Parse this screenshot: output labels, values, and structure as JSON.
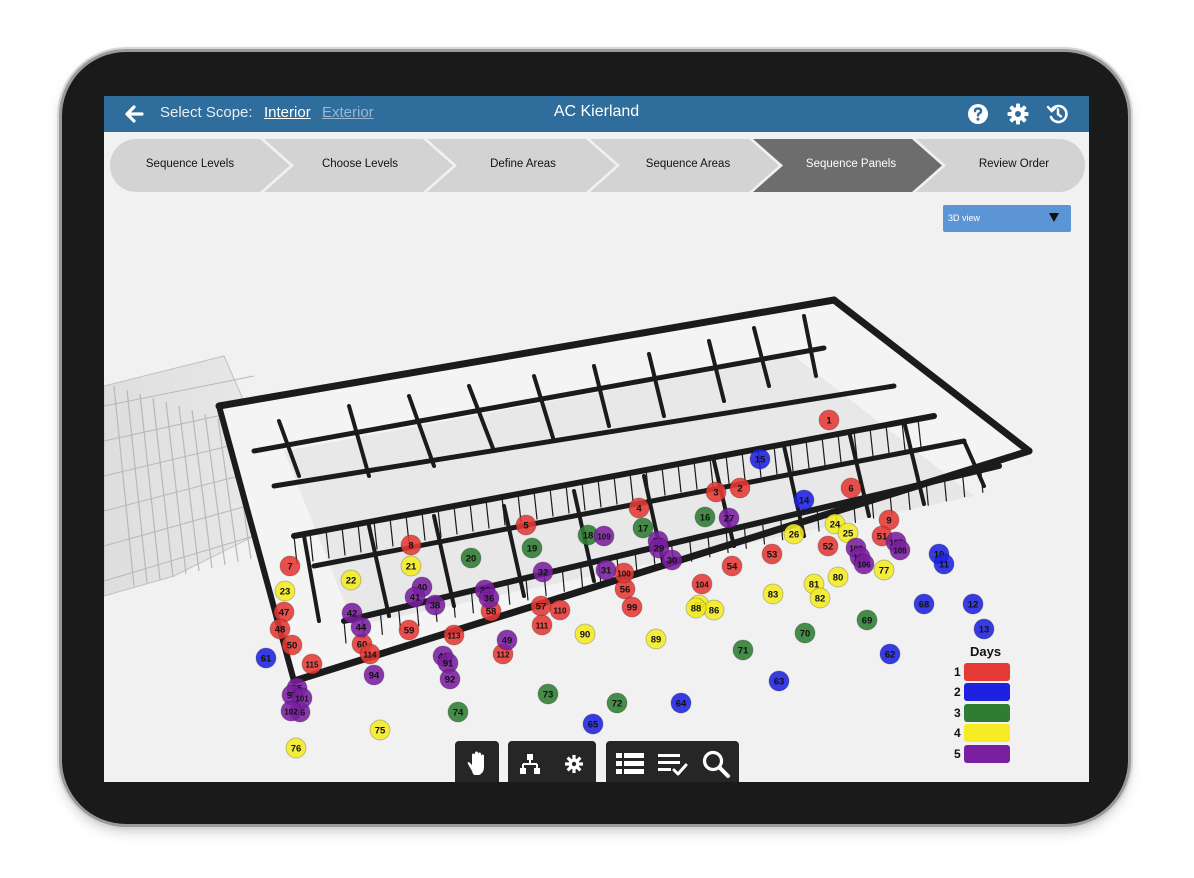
{
  "header": {
    "scope_label": "Select Scope:",
    "scope_interior": "Interior",
    "scope_exterior": "Exterior",
    "title": "AC Kierland",
    "icons": [
      "back-arrow-icon",
      "help-icon",
      "gear-icon",
      "history-icon"
    ]
  },
  "steps": [
    {
      "label": "Sequence Levels",
      "active": false
    },
    {
      "label": "Choose Levels",
      "active": false
    },
    {
      "label": "Define Areas",
      "active": false
    },
    {
      "label": "Sequence Areas",
      "active": false
    },
    {
      "label": "Sequence Panels",
      "active": true
    },
    {
      "label": "Review Order",
      "active": false
    }
  ],
  "view_select": {
    "selected": "3D view"
  },
  "legend": {
    "title": "Days",
    "items": [
      {
        "label": "1",
        "color": "#e53935"
      },
      {
        "label": "2",
        "color": "#1e22e0"
      },
      {
        "label": "3",
        "color": "#2e7d32"
      },
      {
        "label": "4",
        "color": "#f5ec24"
      },
      {
        "label": "5",
        "color": "#7b1fa2"
      }
    ]
  },
  "toolbar": {
    "icons": [
      "hand-pan-icon",
      "hierarchy-icon",
      "settings-icon",
      "list-icon",
      "checklist-icon",
      "search-icon"
    ]
  },
  "panels": [
    {
      "n": "1",
      "day": 1
    },
    {
      "n": "2",
      "day": 1
    },
    {
      "n": "3",
      "day": 1
    },
    {
      "n": "4",
      "day": 1
    },
    {
      "n": "5",
      "day": 1
    },
    {
      "n": "6",
      "day": 1
    },
    {
      "n": "7",
      "day": 1
    },
    {
      "n": "8",
      "day": 1
    },
    {
      "n": "9",
      "day": 1
    },
    {
      "n": "51",
      "day": 1
    },
    {
      "n": "52",
      "day": 1
    },
    {
      "n": "53",
      "day": 1
    },
    {
      "n": "54",
      "day": 1
    },
    {
      "n": "56",
      "day": 1
    },
    {
      "n": "57",
      "day": 1
    },
    {
      "n": "58",
      "day": 1
    },
    {
      "n": "59",
      "day": 1
    },
    {
      "n": "60",
      "day": 1
    },
    {
      "n": "99",
      "day": 1
    },
    {
      "n": "100",
      "day": 1
    },
    {
      "n": "104",
      "day": 1
    },
    {
      "n": "110",
      "day": 1
    },
    {
      "n": "111",
      "day": 1
    },
    {
      "n": "112",
      "day": 1
    },
    {
      "n": "113",
      "day": 1
    },
    {
      "n": "114",
      "day": 1
    },
    {
      "n": "115",
      "day": 1
    },
    {
      "n": "47",
      "day": 1
    },
    {
      "n": "48",
      "day": 1
    },
    {
      "n": "50",
      "day": 1
    },
    {
      "n": "10",
      "day": 2
    },
    {
      "n": "11",
      "day": 2
    },
    {
      "n": "12",
      "day": 2
    },
    {
      "n": "13",
      "day": 2
    },
    {
      "n": "14",
      "day": 2
    },
    {
      "n": "15",
      "day": 2
    },
    {
      "n": "61",
      "day": 2
    },
    {
      "n": "62",
      "day": 2
    },
    {
      "n": "63",
      "day": 2
    },
    {
      "n": "64",
      "day": 2
    },
    {
      "n": "65",
      "day": 2
    },
    {
      "n": "66",
      "day": 2
    },
    {
      "n": "67",
      "day": 2
    },
    {
      "n": "68",
      "day": 2
    },
    {
      "n": "16",
      "day": 3
    },
    {
      "n": "17",
      "day": 3
    },
    {
      "n": "18",
      "day": 3
    },
    {
      "n": "19",
      "day": 3
    },
    {
      "n": "20",
      "day": 3
    },
    {
      "n": "69",
      "day": 3
    },
    {
      "n": "70",
      "day": 3
    },
    {
      "n": "71",
      "day": 3
    },
    {
      "n": "72",
      "day": 3
    },
    {
      "n": "73",
      "day": 3
    },
    {
      "n": "74",
      "day": 3
    },
    {
      "n": "21",
      "day": 4
    },
    {
      "n": "22",
      "day": 4
    },
    {
      "n": "23",
      "day": 4
    },
    {
      "n": "24",
      "day": 4
    },
    {
      "n": "25",
      "day": 4
    },
    {
      "n": "26",
      "day": 4
    },
    {
      "n": "75",
      "day": 4
    },
    {
      "n": "76",
      "day": 4
    },
    {
      "n": "77",
      "day": 4
    },
    {
      "n": "80",
      "day": 4
    },
    {
      "n": "81",
      "day": 4
    },
    {
      "n": "82",
      "day": 4
    },
    {
      "n": "83",
      "day": 4
    },
    {
      "n": "85",
      "day": 4
    },
    {
      "n": "86",
      "day": 4
    },
    {
      "n": "88",
      "day": 4
    },
    {
      "n": "89",
      "day": 4
    },
    {
      "n": "90",
      "day": 4
    },
    {
      "n": "27",
      "day": 5
    },
    {
      "n": "28",
      "day": 5
    },
    {
      "n": "29",
      "day": 5
    },
    {
      "n": "30",
      "day": 5
    },
    {
      "n": "31",
      "day": 5
    },
    {
      "n": "32",
      "day": 5
    },
    {
      "n": "33",
      "day": 5
    },
    {
      "n": "36",
      "day": 5
    },
    {
      "n": "38",
      "day": 5
    },
    {
      "n": "40",
      "day": 5
    },
    {
      "n": "41",
      "day": 5
    },
    {
      "n": "42",
      "day": 5
    },
    {
      "n": "44",
      "day": 5
    },
    {
      "n": "46",
      "day": 5
    },
    {
      "n": "49",
      "day": 5
    },
    {
      "n": "91",
      "day": 5
    },
    {
      "n": "92",
      "day": 5
    },
    {
      "n": "94",
      "day": 5
    },
    {
      "n": "95",
      "day": 5
    },
    {
      "n": "96",
      "day": 5
    },
    {
      "n": "97",
      "day": 5
    },
    {
      "n": "101",
      "day": 5
    },
    {
      "n": "102",
      "day": 5
    },
    {
      "n": "103",
      "day": 5
    },
    {
      "n": "105",
      "day": 5
    },
    {
      "n": "106",
      "day": 5
    },
    {
      "n": "107",
      "day": 5
    },
    {
      "n": "108",
      "day": 5
    },
    {
      "n": "109",
      "day": 5
    }
  ]
}
